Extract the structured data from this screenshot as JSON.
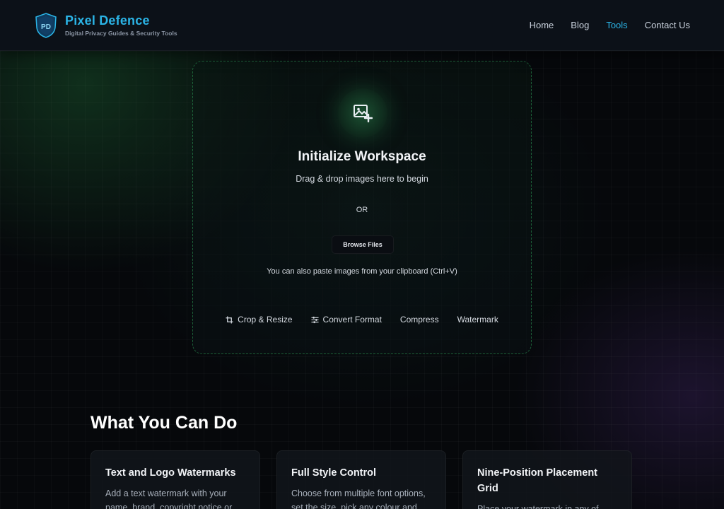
{
  "brand": {
    "title": "Pixel Defence",
    "subtitle": "Digital Privacy Guides & Security Tools"
  },
  "nav": {
    "items": [
      {
        "label": "Home",
        "active": false
      },
      {
        "label": "Blog",
        "active": false
      },
      {
        "label": "Tools",
        "active": true
      },
      {
        "label": "Contact Us",
        "active": false
      }
    ]
  },
  "dropzone": {
    "icon": "image-add-icon",
    "title": "Initialize Workspace",
    "subtitle": "Drag & drop images here to begin",
    "or_text": "OR",
    "browse_label": "Browse Files",
    "paste_hint": "You can also paste images from your clipboard (Ctrl+V)",
    "features": [
      {
        "label": "Crop & Resize",
        "icon": "crop-icon"
      },
      {
        "label": "Convert Format",
        "icon": "sliders-icon"
      },
      {
        "label": "Compress",
        "icon": ""
      },
      {
        "label": "Watermark",
        "icon": ""
      }
    ]
  },
  "section": {
    "title": "What You Can Do",
    "cards": [
      {
        "title": "Text and Logo Watermarks",
        "text": "Add a text watermark with your name, brand, copyright notice or"
      },
      {
        "title": "Full Style Control",
        "text": "Choose from multiple font options, set the size, pick any colour and"
      },
      {
        "title": "Nine-Position Placement Grid",
        "text": "Place your watermark in any of"
      }
    ]
  },
  "colors": {
    "accent": "#2bb4e6",
    "dropzone_border": "#2ea05a",
    "background": "#06080b"
  }
}
